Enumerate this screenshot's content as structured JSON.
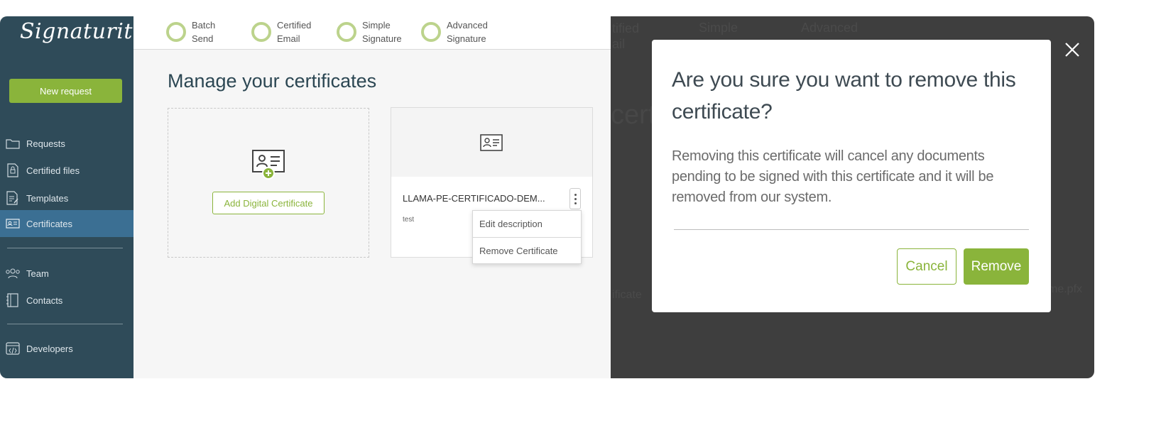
{
  "brand": {
    "logo_text": "Signaturit",
    "accent": "#8ab43b",
    "sidebar_bg": "#2f4b59",
    "active_bg": "#3b6f93"
  },
  "sidebar": {
    "new_request": "New request",
    "items": [
      {
        "label": "Requests",
        "icon": "folder-icon"
      },
      {
        "label": "Certified files",
        "icon": "certified-file-icon"
      },
      {
        "label": "Templates",
        "icon": "template-icon"
      },
      {
        "label": "Certificates",
        "icon": "certificate-icon",
        "active": true
      },
      {
        "label": "Team",
        "icon": "team-icon"
      },
      {
        "label": "Contacts",
        "icon": "contacts-book-icon"
      },
      {
        "label": "Developers",
        "icon": "code-icon"
      }
    ]
  },
  "steps": [
    {
      "label": "Batch\nSend"
    },
    {
      "label": "Certified\nEmail"
    },
    {
      "label": "Simple\nSignature"
    },
    {
      "label": "Advanced\nSignature"
    }
  ],
  "main": {
    "title": "Manage your certificates",
    "add_button": "Add Digital Certificate",
    "certificate": {
      "name": "LLAMA-PE-CERTIFICADO-DEM...",
      "description": "test"
    },
    "context_menu": [
      "Edit description",
      "Remove Certificate"
    ]
  },
  "background_ghost": {
    "step_2": "tified\nail",
    "step_3": "Simple",
    "step_4": "Advanced",
    "title_fragment": "certi",
    "row_fragment": "ificate",
    "file_fragment": "me.pfx"
  },
  "modal": {
    "title": "Are you sure you want to remove this certificate?",
    "message": "Removing this certificate will cancel any documents pending to be signed with this certificate and it will be removed from our system.",
    "cancel": "Cancel",
    "confirm": "Remove",
    "close_icon": "close-icon"
  }
}
